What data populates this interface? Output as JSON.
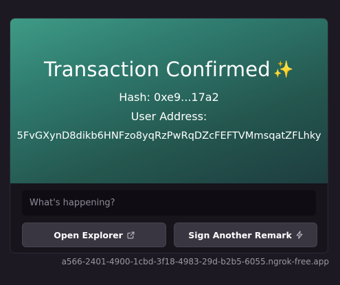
{
  "hero": {
    "title": "Transaction Confirmed",
    "sparkle_glyph": "✨",
    "hash_line": "Hash: 0xe9...17a2",
    "address_label": "User Address:",
    "address_value": "5FvGXynD8dikb6HNFzo8yqRzPwRqDZcFEFTVMmsqatZFLhky"
  },
  "composer": {
    "placeholder": "What's happening?",
    "value": ""
  },
  "actions": {
    "open_explorer_label": "Open Explorer",
    "open_explorer_icon": "external-link-icon",
    "sign_remark_label": "Sign Another Remark",
    "sign_remark_icon": "lightning-icon"
  },
  "footer": {
    "url": "a566-2401-4900-1cbd-3f18-4983-29d-b2b5-6055.ngrok-free.app"
  },
  "colors": {
    "page_background": "#1c1922",
    "hero_gradient_start": "#3e9b85",
    "hero_gradient_end": "#1e3d3f",
    "button_background": "#3a3641",
    "input_background": "#0f0d13"
  }
}
